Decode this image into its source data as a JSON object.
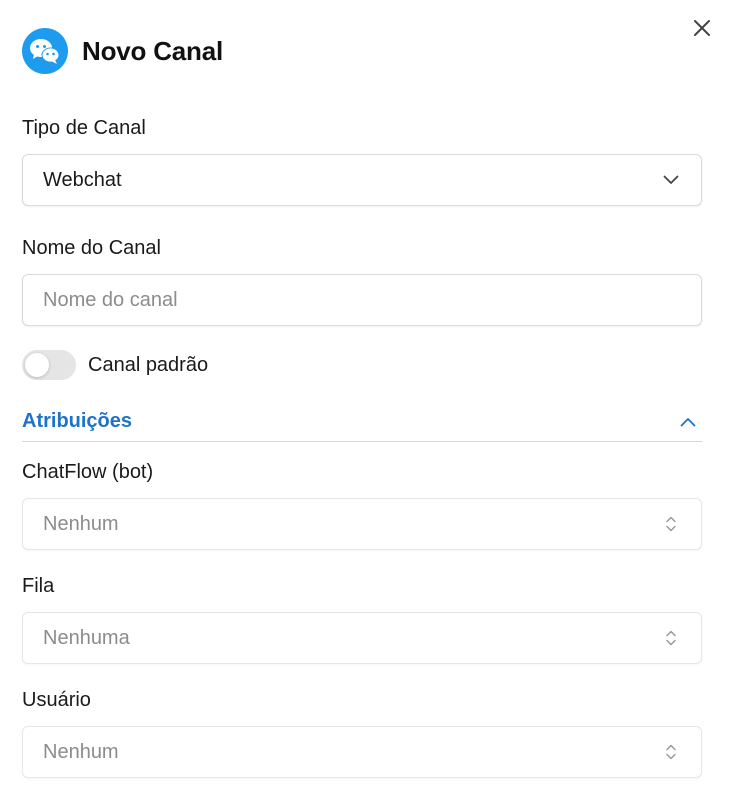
{
  "header": {
    "title": "Novo Canal",
    "logo_icon": "wechat-icon",
    "close_icon": "close-icon"
  },
  "form": {
    "channel_type": {
      "label": "Tipo de Canal",
      "value": "Webchat",
      "icon": "chevron-down-icon"
    },
    "channel_name": {
      "label": "Nome do Canal",
      "value": "",
      "placeholder": "Nome do canal"
    },
    "default_toggle": {
      "label": "Canal padrão",
      "checked": false
    }
  },
  "assignments": {
    "title": "Atribuições",
    "expanded": true,
    "icon": "chevron-up-icon",
    "chatflow": {
      "label": "ChatFlow (bot)",
      "value": "Nenhum"
    },
    "queue": {
      "label": "Fila",
      "value": "Nenhuma"
    },
    "user": {
      "label": "Usuário",
      "value": "Nenhum"
    }
  },
  "colors": {
    "accent": "#1e73c8",
    "logo_bg": "#1c9bef",
    "muted_text": "#8c8c8c",
    "border": "#d9d9d9"
  }
}
